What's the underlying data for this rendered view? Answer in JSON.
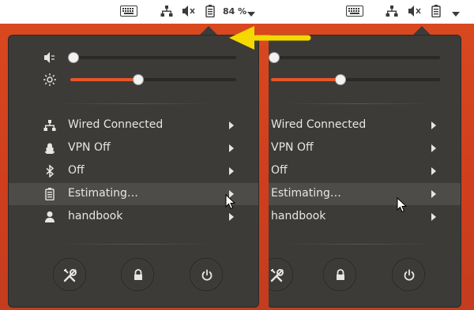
{
  "screenshot_left": {
    "topbar": {
      "battery_percent": "84 %"
    },
    "menu": {
      "items": [
        {
          "label": "Wired Connected"
        },
        {
          "label": "VPN Off"
        },
        {
          "label": "Off"
        },
        {
          "label": "Estimating…"
        },
        {
          "label": "handbook"
        }
      ]
    },
    "sliders": {
      "volume_level": 0.02,
      "brightness_level": 0.41
    }
  },
  "screenshot_right": {
    "menu": {
      "items": [
        {
          "label": "Wired Connected"
        },
        {
          "label": "VPN Off"
        },
        {
          "label": "Off"
        },
        {
          "label": "Estimating…"
        },
        {
          "label": "handbook"
        }
      ]
    },
    "sliders": {
      "volume_level": 0.02,
      "brightness_level": 0.41
    }
  },
  "icons": {
    "volume": "volume-muted-icon",
    "brightness": "brightness-icon",
    "network": "wired-network-icon",
    "vpn": "vpn-lock-icon",
    "bluetooth": "bluetooth-icon",
    "battery": "battery-icon",
    "user": "user-icon",
    "settings": "settings-icon",
    "lock": "lock-icon",
    "power": "power-icon",
    "keyboard": "keyboard-icon"
  },
  "colors": {
    "desktop": "#d9481f",
    "panel": "#3c3b37",
    "accent": "#e9552a",
    "annotation_arrow": "#f5d800"
  }
}
